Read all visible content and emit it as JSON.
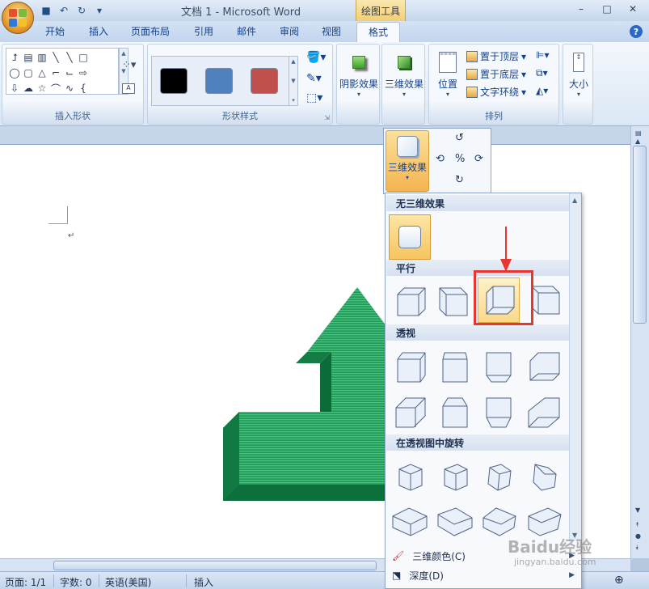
{
  "title": "文档 1 - Microsoft Word",
  "contextual_tab": "绘图工具",
  "tabs": [
    "开始",
    "插入",
    "页面布局",
    "引用",
    "邮件",
    "审阅",
    "视图",
    "格式"
  ],
  "active_tab": "格式",
  "ribbon": {
    "insert_shapes_label": "插入形状",
    "shape_styles_label": "形状样式",
    "shadow_effects": "阴影效果",
    "effects_3d": "三维效果",
    "position": "位置",
    "bring_to_front": "置于顶层",
    "send_to_back": "置于底层",
    "text_wrap": "文字环绕",
    "arrange_label": "排列",
    "size": "大小",
    "swatch_colors": [
      "#000000",
      "#4f81bd",
      "#c0504d"
    ]
  },
  "popup": {
    "effects_3d_button": "三维效果"
  },
  "gallery": {
    "section_none": "无三维效果",
    "section_parallel": "平行",
    "section_perspective": "透视",
    "section_rotate_perspective": "在透视图中旋转",
    "item_color": "三维颜色(C)",
    "item_depth": "深度(D)"
  },
  "status": {
    "page": "页面: 1/1",
    "words": "字数: 0",
    "language": "英语(美国)",
    "mode": "插入"
  },
  "watermark": "Baidu经验",
  "watermark_sub": "jingyan.baidu.com"
}
